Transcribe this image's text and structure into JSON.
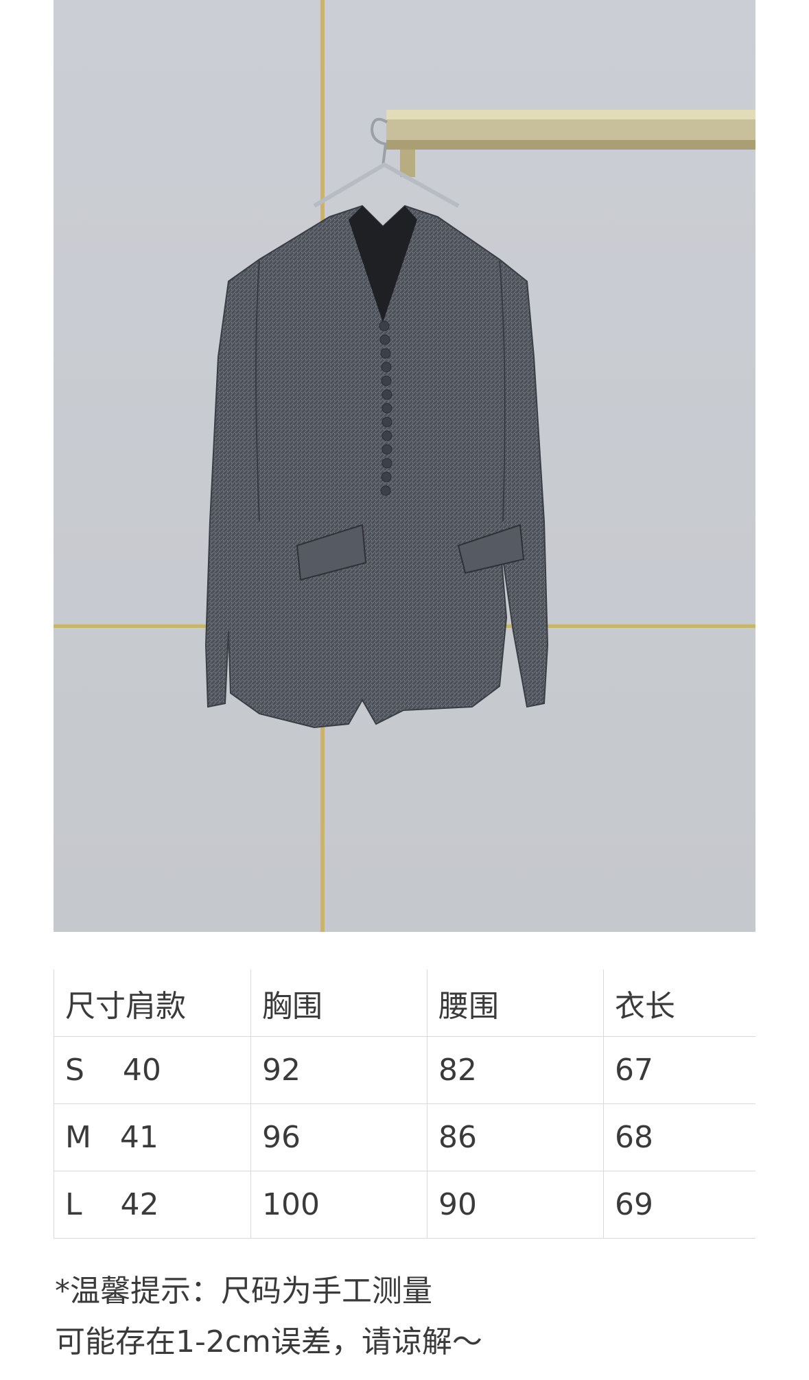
{
  "table": {
    "headers": [
      "尺寸肩款",
      "胸围",
      "腰围",
      "衣长"
    ],
    "rows": [
      [
        "S    40",
        "92",
        "82",
        "67"
      ],
      [
        "M   41",
        "96",
        "86",
        "68"
      ],
      [
        "L    42",
        "100",
        "90",
        "69"
      ]
    ]
  },
  "note": {
    "line1": "*温馨提示：尺码为手工测量",
    "line2": "可能存在1-2cm误差，请谅解～"
  },
  "colors": {
    "wall": "#cfd2d7",
    "gold_trim": "#c9b46a",
    "jacket": "#4a4e57",
    "border": "#d9d9d9",
    "text": "#3a3a3a"
  }
}
